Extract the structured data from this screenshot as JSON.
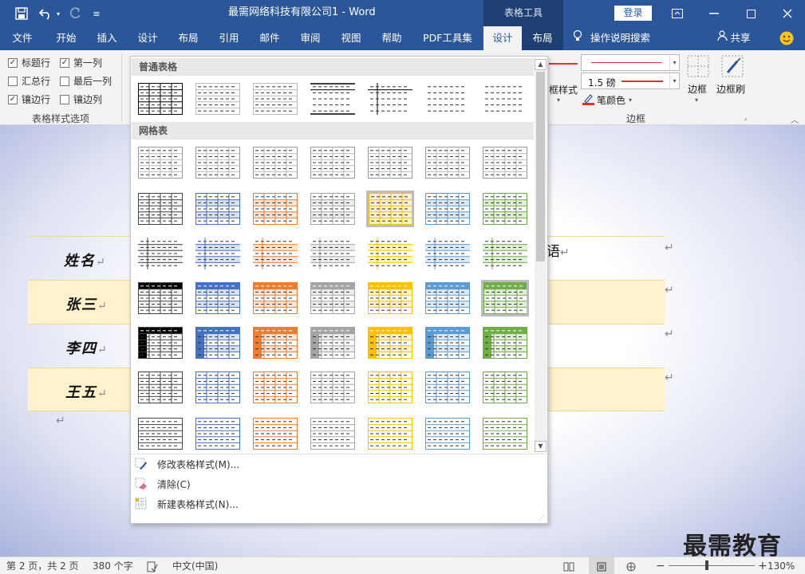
{
  "titlebar": {
    "title": "最需网络科技有限公司1  -  Word",
    "context_tab": "表格工具",
    "login": "登录"
  },
  "tabs": [
    {
      "label": "文件"
    },
    {
      "label": "开始"
    },
    {
      "label": "插入"
    },
    {
      "label": "设计"
    },
    {
      "label": "布局"
    },
    {
      "label": "引用"
    },
    {
      "label": "邮件"
    },
    {
      "label": "审阅"
    },
    {
      "label": "视图"
    },
    {
      "label": "帮助"
    },
    {
      "label": "PDF工具集"
    },
    {
      "label": "设计"
    },
    {
      "label": "布局"
    }
  ],
  "tell_me": "操作说明搜索",
  "share": "共享",
  "ribbon": {
    "options": {
      "header_row": "标题行",
      "first_column": "第一列",
      "total_row": "汇总行",
      "last_column": "最后一列",
      "banded_rows": "镶边行",
      "banded_columns": "镶边列",
      "group_label": "表格样式选项"
    },
    "border_styles": "框样式",
    "pen_weight": "1.5 磅",
    "pen_color": "笔颜色",
    "borders": "边框",
    "border_painter": "边框刷",
    "borders_group": "边框"
  },
  "gallery": {
    "section_plain": "普通表格",
    "section_grid": "网格表",
    "modify": "修改表格样式(M)...",
    "clear": "清除(C)",
    "new_style": "新建表格样式(N)..."
  },
  "document": {
    "rows": [
      {
        "name": "姓名",
        "right": "语"
      },
      {
        "name": "张三",
        "right": ""
      },
      {
        "name": "李四",
        "right": ""
      },
      {
        "name": "王五",
        "right": ""
      }
    ],
    "paragraph_mark": "↵"
  },
  "watermark": "最需教育",
  "statusbar": {
    "page": "第 2 页，共 2 页",
    "words": "380 个字",
    "language": "中文(中国)",
    "zoom": "130%"
  },
  "colors": {
    "brand": "#2b579a",
    "accents": [
      "#000000",
      "#4472c4",
      "#ed7d31",
      "#a5a5a5",
      "#ffc000",
      "#5b9bd5",
      "#70ad47"
    ]
  }
}
